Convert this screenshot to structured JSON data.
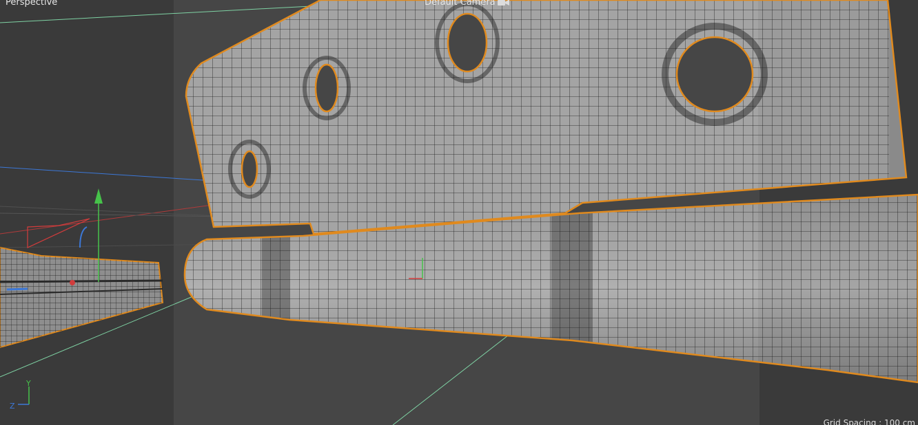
{
  "viewport": {
    "view_name": "Perspective",
    "camera_name": "Default Camera",
    "grid_spacing": "Grid Spacing : 100 cm"
  },
  "axis_indicator": {
    "y_label": "Y",
    "z_label": "Z"
  },
  "icons": [
    "camera-icon",
    "move-gizmo-icon",
    "axis-triad-icon"
  ],
  "colors": {
    "viewport_bg": "#3d3d3d",
    "safe_frame_bg": "#474747",
    "mesh_fill": "#a3a3a3",
    "wireframe": "#1a1a1a",
    "selection_outline": "#e08a1e",
    "axis_x": "#d23c3c",
    "axis_y": "#46c24a",
    "axis_z": "#3c78d8",
    "world_grid_line": "#7fd3a4"
  }
}
